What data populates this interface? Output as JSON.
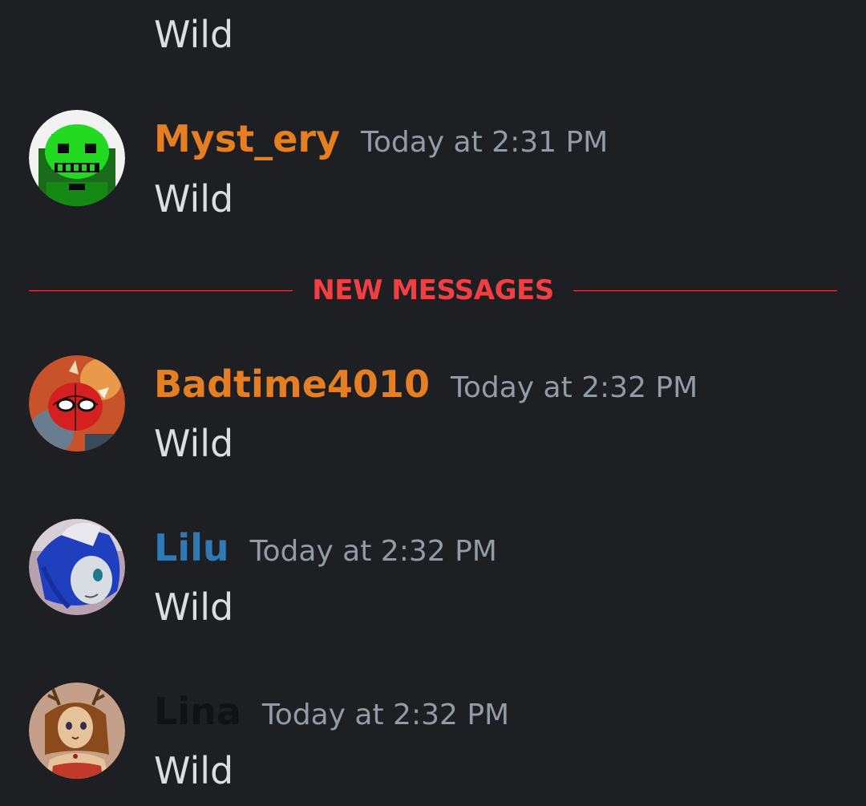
{
  "colors": {
    "background": "#1e1f22",
    "message_text": "#dbdee1",
    "timestamp": "#949ba4",
    "new_messages": "#f23f43"
  },
  "previous": {
    "text": "Wild"
  },
  "divider": {
    "label": "NEW MESSAGES"
  },
  "messages": [
    {
      "username": "Myst_ery",
      "username_color": "#e67e22",
      "timestamp": "Today at 2:31 PM",
      "text": "Wild",
      "avatar": "green-skull-avatar"
    },
    {
      "username": "Badtime4010",
      "username_color": "#e67e22",
      "timestamp": "Today at 2:32 PM",
      "text": "Wild",
      "avatar": "spider-hero-avatar"
    },
    {
      "username": "Lilu",
      "username_color": "#2f79b4",
      "timestamp": "Today at 2:32 PM",
      "text": "Wild",
      "avatar": "blue-hair-character-avatar"
    },
    {
      "username": "Lina",
      "username_color": "#111214",
      "timestamp": "Today at 2:32 PM",
      "text": "Wild",
      "avatar": "deer-girl-avatar"
    }
  ]
}
